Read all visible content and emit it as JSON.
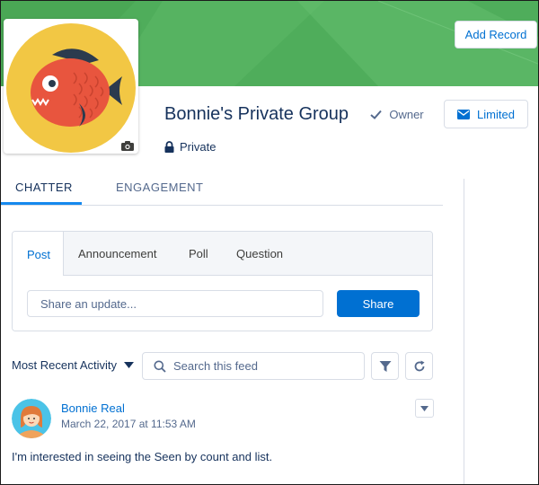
{
  "header": {
    "add_record_label": "Add Record",
    "group_name": "Bonnie's Private Group",
    "privacy": "Private",
    "owner_label": "Owner",
    "limited_label": "Limited"
  },
  "tabs": [
    {
      "label": "CHATTER",
      "active": true
    },
    {
      "label": "ENGAGEMENT",
      "active": false
    }
  ],
  "publisher": {
    "tabs": [
      {
        "label": "Post",
        "active": true
      },
      {
        "label": "Announcement",
        "active": false
      },
      {
        "label": "Poll",
        "active": false
      },
      {
        "label": "Question",
        "active": false
      }
    ],
    "input_placeholder": "Share an update...",
    "share_label": "Share"
  },
  "feed": {
    "sort_label": "Most Recent Activity",
    "search_placeholder": "Search this feed"
  },
  "post": {
    "author": "Bonnie Real",
    "timestamp": "March 22, 2017 at 11:53 AM",
    "body": "I'm interested in seeing the Seen by count and list."
  },
  "colors": {
    "brand_blue": "#0070d2",
    "banner_green": "#4fad5b",
    "avatar_yellow": "#f2c744",
    "fish_red": "#e8553e"
  },
  "icons": [
    "camera-icon",
    "lock-icon",
    "check-icon",
    "mail-icon",
    "chevron-down-icon",
    "search-icon",
    "filter-icon",
    "refresh-icon"
  ]
}
